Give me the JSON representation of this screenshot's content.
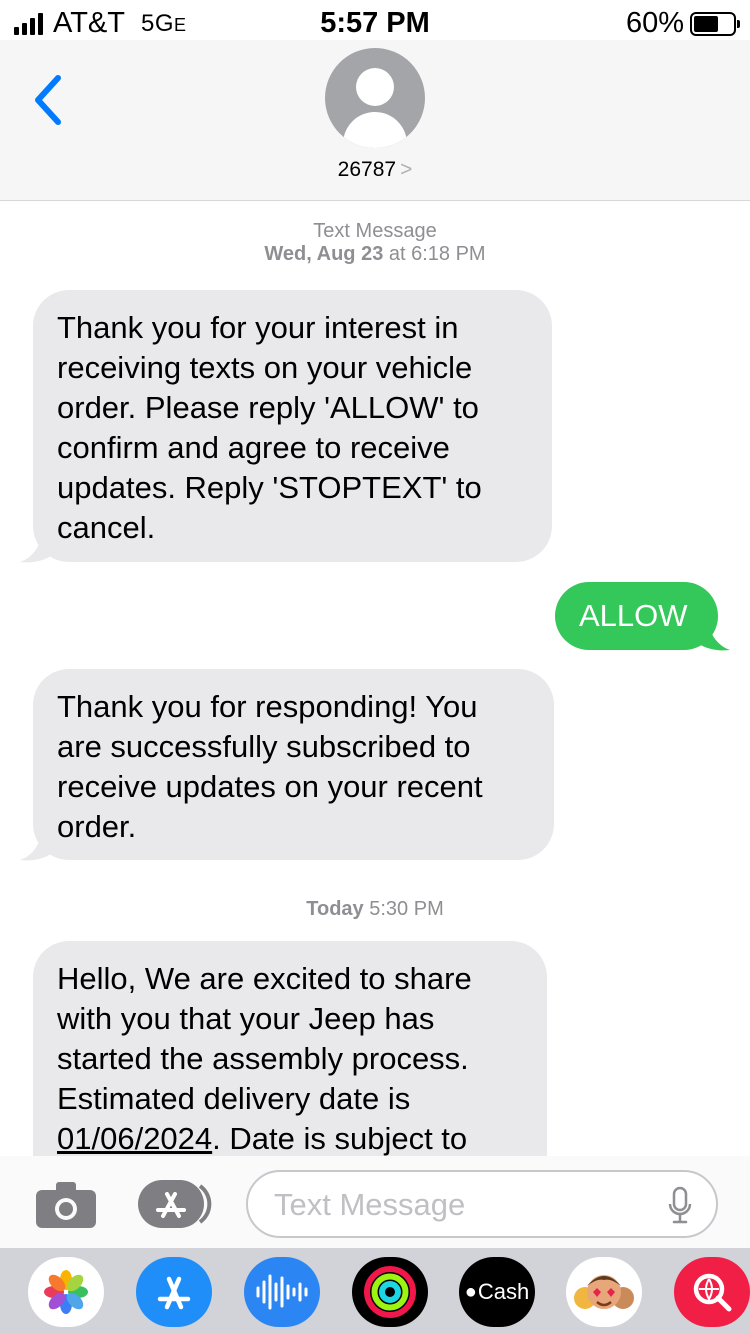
{
  "status_bar": {
    "carrier": "AT&T",
    "network": "5G",
    "network_suffix": "E",
    "time": "5:57 PM",
    "battery": "60%",
    "battery_level": 0.6
  },
  "header": {
    "contact_name": "26787",
    "chevron": ">"
  },
  "conversation": {
    "meta1_label": "Text Message",
    "meta1_date_bold": "Wed, Aug 23",
    "meta1_time": " at 6:18 PM",
    "messages": [
      {
        "from": "them",
        "text": "Thank you for your interest in receiving texts on your vehicle order. Please reply 'ALLOW' to confirm and agree to receive updates. Reply 'STOPTEXT' to cancel."
      },
      {
        "from": "me",
        "text": "ALLOW"
      },
      {
        "from": "them",
        "text": "Thank you for responding! You are successfully subscribed to receive updates on your recent order."
      }
    ],
    "meta2_bold": "Today",
    "meta2_time": " 5:30 PM",
    "last_message": {
      "line1": "Hello, We are excited to share",
      "line2": "with you that your Jeep has",
      "line3": "started the assembly process.",
      "line4": "Estimated delivery date is",
      "date_link": "01/06/2024",
      "line5_rest": ". Date is subject to"
    }
  },
  "compose": {
    "placeholder": "Text Message"
  },
  "app_drawer": {
    "cash_label": "Cash"
  },
  "colors": {
    "outgoing_bubble": "#34c759",
    "incoming_bubble": "#e9e9eb",
    "ios_blue": "#007aff"
  }
}
